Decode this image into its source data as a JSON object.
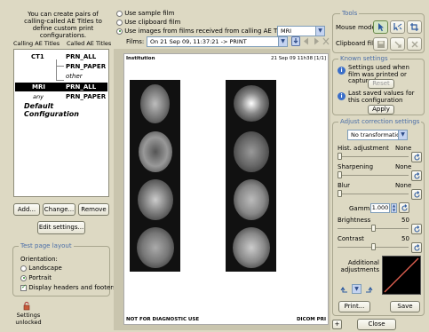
{
  "left": {
    "intro": "You can create pairs of calling-called AE Titles to define custom print configurations.",
    "col_calling": "Calling AE Titles",
    "col_called": "Called AE Titles",
    "tree": [
      {
        "calling": "CT1",
        "called": "PRN_ALL"
      },
      {
        "calling": "",
        "called": "PRN_PAPER"
      },
      {
        "calling": "",
        "called": "other"
      },
      {
        "calling": "MRI",
        "called": "PRN_ALL"
      },
      {
        "calling": "any",
        "called": "PRN_PAPER"
      }
    ],
    "default_config": "Default Configuration",
    "add": "Add...",
    "change": "Change...",
    "remove": "Remove",
    "edit_settings": "Edit settings...",
    "test_page_title": "Test page layout",
    "orientation_label": "Orientation:",
    "landscape": "Landscape",
    "portrait": "Portrait",
    "display_headers": "Display headers and footers",
    "settings_status": "Settings unlocked"
  },
  "top": {
    "use_sample": "Use sample film",
    "use_clipboard": "Use clipboard film",
    "use_received": "Use images from films received from calling AE Title:",
    "ae_title_value": "MRI",
    "films_label": "Films:",
    "films_value": "On 21 Sep 09, 11:37:21 -> PRINT"
  },
  "film": {
    "header_left": "Institution",
    "header_right": "21 Sep 09 11h38 [1/1]",
    "footer_left": "NOT FOR DIAGNOSTIC USE",
    "footer_right": "DICOM PRI"
  },
  "right": {
    "tools_title": "Tools",
    "mouse_mode": "Mouse mode:",
    "clipboard_film": "Clipboard film:",
    "known_title": "Known settings",
    "known_text": "Settings used when film was printed or captured",
    "reset": "Reset",
    "last_saved": "Last saved values for this configuration",
    "apply": "Apply",
    "adjust_title": "Adjust correction settings",
    "transformation": "No transformation",
    "hist_label": "Hist. adjustment",
    "hist_value": "None",
    "sharpening_label": "Sharpening",
    "sharpening_value": "None",
    "blur_label": "Blur",
    "blur_value": "None",
    "gamma_label": "Gamma",
    "gamma_value": "1.000",
    "brightness_label": "Brightness",
    "brightness_value": "50",
    "contrast_label": "Contrast",
    "contrast_value": "50",
    "additional": "Additional adjustments",
    "print": "Print...",
    "save": "Save",
    "close": "Close",
    "plus": "+"
  },
  "colors": {
    "background": "#ddd9c3",
    "selection": "#000000",
    "accent_blue": "#4a6ea8"
  }
}
